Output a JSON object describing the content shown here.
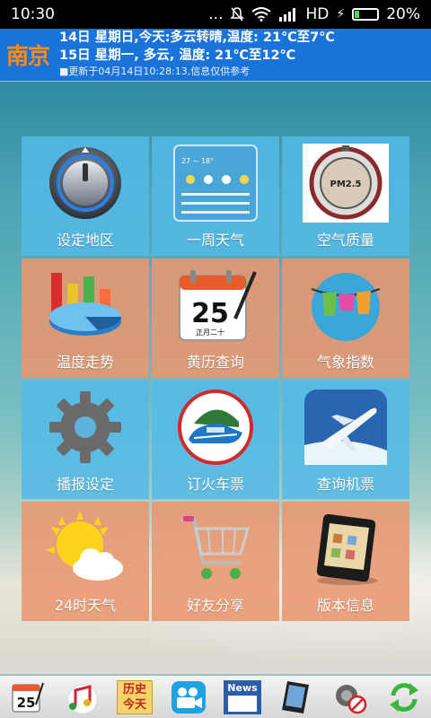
{
  "status_bar": {
    "time": "10:30",
    "indicators": "... ",
    "network": "HD",
    "battery": "20%",
    "battery_level": 0.2
  },
  "header": {
    "city": "南京",
    "day1": "14日 星期日,今天:多云转晴,温度: 21℃至7℃",
    "day2": "15日 星期一, 多云, 温度: 21℃至12℃",
    "update_note": "■更新于04月14日10:28:13,信息仅供参考"
  },
  "tiles": [
    {
      "label": "设定地区",
      "icon": "knob-icon",
      "color": "blue"
    },
    {
      "label": "一周天气",
      "icon": "weekly-weather-icon",
      "color": "blue"
    },
    {
      "label": "空气质量",
      "icon": "pm25-gauge-icon",
      "color": "blue"
    },
    {
      "label": "温度走势",
      "icon": "bar-chart-icon",
      "color": "orange"
    },
    {
      "label": "黄历查询",
      "icon": "calendar-icon",
      "color": "orange"
    },
    {
      "label": "气象指数",
      "icon": "clothes-line-icon",
      "color": "orange"
    },
    {
      "label": "播报设定",
      "icon": "gear-icon",
      "color": "blue"
    },
    {
      "label": "订火车票",
      "icon": "train-icon",
      "color": "blue"
    },
    {
      "label": "查询机票",
      "icon": "airplane-icon",
      "color": "blue"
    },
    {
      "label": "24时天气",
      "icon": "sun-cloud-icon",
      "color": "orange"
    },
    {
      "label": "好友分享",
      "icon": "shopping-cart-icon",
      "color": "orange"
    },
    {
      "label": "版本信息",
      "icon": "smartphone-icon",
      "color": "orange"
    }
  ],
  "icon_text": {
    "calendar_day": "25",
    "calendar_sub": "正月二十",
    "pm25": "PM2.5",
    "weekly_temp": "27 ~ 18°"
  },
  "bottom_bar": {
    "history_line1": "历史",
    "history_line2": "今天",
    "news": "News",
    "calendar_day": "25"
  },
  "colors": {
    "header_blue": "#1a73d9",
    "city_orange": "#ff8c1a",
    "tile_blue": "#54bae8",
    "tile_orange": "#e99670"
  }
}
